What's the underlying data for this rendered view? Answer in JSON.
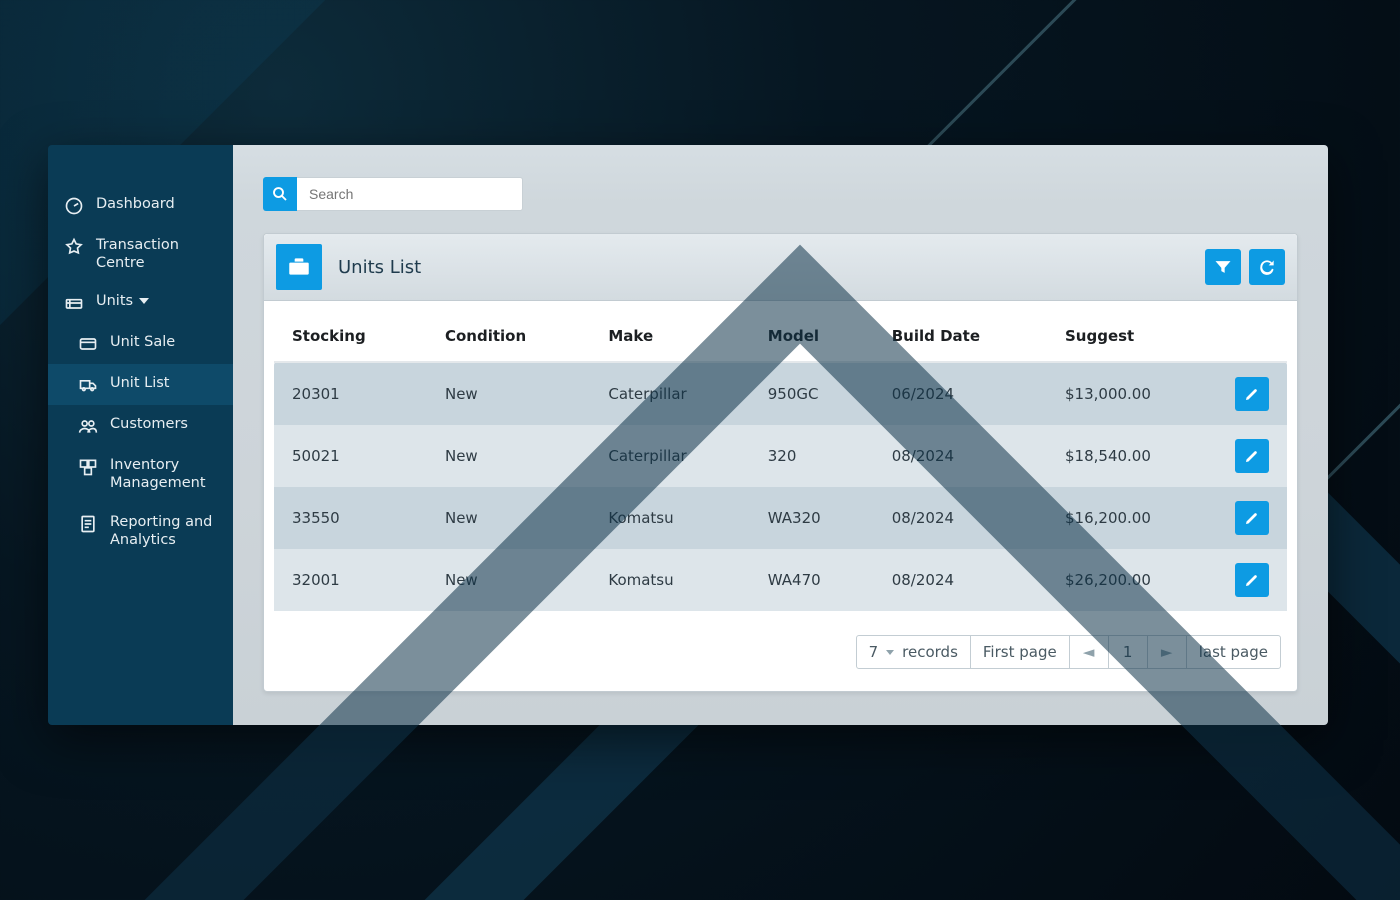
{
  "sidebar": {
    "items": [
      {
        "id": "dashboard",
        "label": "Dashboard",
        "icon": "gauge-icon"
      },
      {
        "id": "transactions",
        "label": "Transaction Centre",
        "icon": "star-icon"
      },
      {
        "id": "units",
        "label": "Units",
        "icon": "units-icon",
        "expandable": true
      },
      {
        "id": "unit-sale",
        "label": "Unit Sale",
        "icon": "card-icon",
        "sub": true
      },
      {
        "id": "unit-list",
        "label": "Unit List",
        "icon": "truck-icon",
        "sub": true,
        "active": true
      },
      {
        "id": "customers",
        "label": "Customers",
        "icon": "people-icon",
        "sub": true
      },
      {
        "id": "inventory",
        "label": "Inventory Management",
        "icon": "boxes-icon",
        "sub": true
      },
      {
        "id": "reporting",
        "label": "Reporting and Analytics",
        "icon": "report-icon",
        "sub": true
      }
    ]
  },
  "search": {
    "placeholder": "Search"
  },
  "panel": {
    "title": "Units List",
    "columns": [
      "Stocking",
      "Condition",
      "Make",
      "Model",
      "Build Date",
      "Suggest"
    ],
    "rows": [
      {
        "stocking": "20301",
        "condition": "New",
        "make": "Caterpillar",
        "model": "950GC",
        "build_date": "06/2024",
        "suggest": "$13,000.00"
      },
      {
        "stocking": "50021",
        "condition": "New",
        "make": "Caterpillar",
        "model": "320",
        "build_date": "08/2024",
        "suggest": "$18,540.00"
      },
      {
        "stocking": "33550",
        "condition": "New",
        "make": "Komatsu",
        "model": "WA320",
        "build_date": "08/2024",
        "suggest": "$16,200.00"
      },
      {
        "stocking": "32001",
        "condition": "New",
        "make": "Komatsu",
        "model": "WA470",
        "build_date": "08/2024",
        "suggest": "$26,200.00"
      }
    ]
  },
  "pager": {
    "page_size": "7",
    "records_label": "records",
    "first_label": "First page",
    "last_label": "last page",
    "current_page": "1"
  },
  "colors": {
    "accent": "#0d9be3",
    "sidebar": "#0a3b55"
  }
}
